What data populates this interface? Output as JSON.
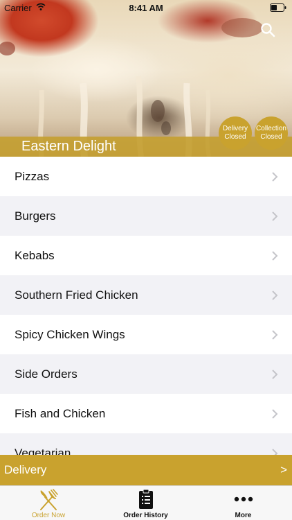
{
  "status_bar": {
    "carrier": "Carrier",
    "time": "8:41 AM",
    "icons": [
      "wifi-icon",
      "battery-icon"
    ]
  },
  "header": {
    "restaurant_name": "Eastern Delight",
    "search_icon": "search-icon",
    "badges": {
      "delivery_line1": "Delivery",
      "delivery_line2": "Closed",
      "collection_line1": "Collection",
      "collection_line2": "Closed"
    }
  },
  "menu": {
    "items": [
      {
        "label": "Pizzas"
      },
      {
        "label": "Burgers"
      },
      {
        "label": "Kebabs"
      },
      {
        "label": "Southern Fried Chicken"
      },
      {
        "label": "Spicy Chicken Wings"
      },
      {
        "label": "Side Orders"
      },
      {
        "label": "Fish and Chicken"
      },
      {
        "label": "Vegetarian"
      }
    ]
  },
  "delivery_bar": {
    "label": "Delivery",
    "arrow": ">"
  },
  "tabs": [
    {
      "label": "Order Now",
      "icon": "fork-knife-icon",
      "active": true
    },
    {
      "label": "Order History",
      "icon": "clipboard-icon",
      "active": false
    },
    {
      "label": "More",
      "icon": "more-dots-icon",
      "active": false
    }
  ],
  "colors": {
    "accent": "#c9a22e",
    "tab_bar_bg": "#f7f7f7",
    "row_alt_bg": "#f2f2f6"
  }
}
